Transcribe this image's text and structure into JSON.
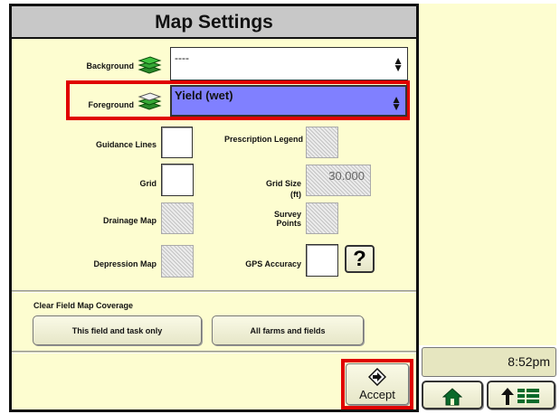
{
  "dialog": {
    "title": "Map Settings",
    "background": {
      "label": "Background",
      "value": "----"
    },
    "foreground": {
      "label": "Foreground",
      "value": "Yield (wet)"
    },
    "guidance_lines": {
      "label": "Guidance Lines"
    },
    "grid": {
      "label": "Grid"
    },
    "drainage_map": {
      "label": "Drainage Map"
    },
    "depression_map": {
      "label": "Depression Map"
    },
    "prescription_legend": {
      "label": "Prescription Legend"
    },
    "grid_size": {
      "label_line1": "Grid Size",
      "label_line2": "(ft)",
      "value": "30.000"
    },
    "survey_points": {
      "label_line1": "Survey",
      "label_line2": "Points"
    },
    "gps_accuracy": {
      "label": "GPS Accuracy",
      "help": "?"
    },
    "clear_coverage": {
      "heading": "Clear Field Map Coverage",
      "this_field_label": "This field and task only",
      "all_farms_label": "All farms and fields"
    },
    "accept_label": "Accept"
  },
  "status": {
    "time": "8:52pm"
  },
  "icons": {
    "layers": "layers-icon",
    "accept": "accept-arrow-icon",
    "home": "home-icon",
    "menu": "up-arrow-menu-icon"
  },
  "colors": {
    "highlight": "#e00000",
    "selected_fill": "#8080ff",
    "panel": "#fdfdd0"
  }
}
